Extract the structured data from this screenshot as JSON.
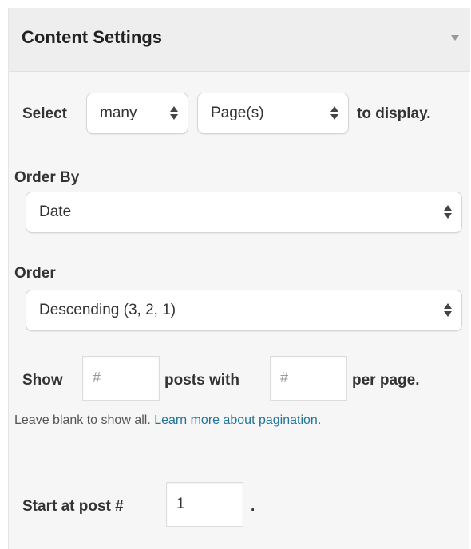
{
  "panel": {
    "title": "Content Settings"
  },
  "select_row": {
    "prefix": "Select",
    "quantity_value": "many",
    "type_value": "Page(s)",
    "suffix": "to display."
  },
  "order_by": {
    "label": "Order By",
    "value": "Date"
  },
  "order": {
    "label": "Order",
    "value": "Descending (3, 2, 1)"
  },
  "pagination": {
    "show_label": "Show",
    "posts_placeholder": "#",
    "posts_with_label": "posts with",
    "per_page_placeholder": "#",
    "per_page_label": "per page.",
    "help_text": "Leave blank to show all. ",
    "help_link_text": "Learn more about pagination",
    "help_end": "."
  },
  "start": {
    "label": "Start at post #",
    "value": "1",
    "suffix": "."
  },
  "colors": {
    "link": "#21759b",
    "panel_bg": "#f6f6f6",
    "header_bg": "#eeeeee"
  }
}
